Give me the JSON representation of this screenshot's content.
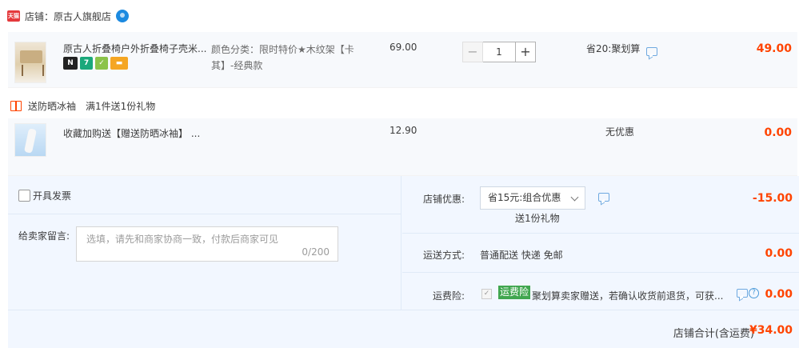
{
  "shop": {
    "badge": "天猫",
    "label": "店铺：原古人旗舰店"
  },
  "items": [
    {
      "title": "原古人折叠椅户外折叠椅子壳米...",
      "sku": "颜色分类：限时特价★木纹架【卡其】-经典款",
      "price": "69.00",
      "quantity": "1",
      "discount": "省20:聚划算",
      "subtotal": "49.00",
      "badges": [
        "new",
        "7",
        "shield",
        "card"
      ]
    },
    {
      "title": "收藏加购送【赠送防晒冰袖】 ...",
      "price": "12.90",
      "discount": "无优惠",
      "subtotal": "0.00"
    }
  ],
  "gift": {
    "label": "送防晒冰袖",
    "desc": "满1件送1份礼物"
  },
  "order": {
    "invoice_label": "开具发票",
    "message_label": "给卖家留言:",
    "message_placeholder": "选填，请先和商家协商一致，付款后商家可见",
    "message_count": "0/200",
    "coupon_label": "店铺优惠:",
    "coupon_value": "省15元:组合优惠",
    "coupon_gift": "送1份礼物",
    "coupon_amount": "-15.00",
    "shipping_label": "运送方式:",
    "shipping_value": "普通配送 快递 免邮",
    "shipping_amount": "0.00",
    "insurance_label": "运费险:",
    "insurance_badge": "运费险",
    "insurance_text": "聚划算卖家赠送，若确认收货前退货，可获...",
    "insurance_amount": "0.00",
    "total_label": "店铺合计(含运费)",
    "total_amount": "¥34.00"
  },
  "colors": {
    "accent": "#ff4400",
    "bg_panel": "#f2f7ff",
    "insurance_green": "#40a64f"
  }
}
